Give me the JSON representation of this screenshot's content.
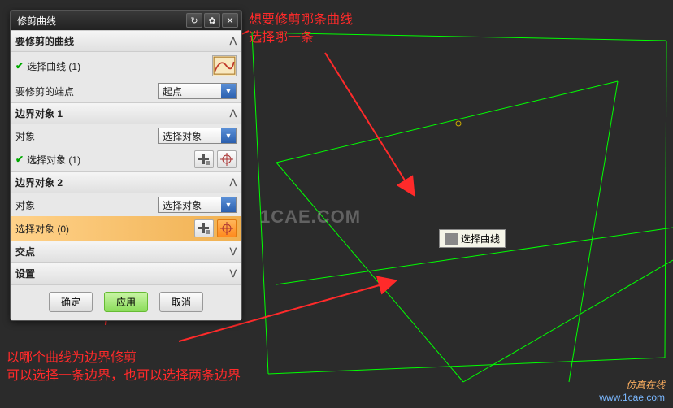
{
  "dialog": {
    "title": "修剪曲线",
    "sections": {
      "s1": {
        "header": "要修剪的曲线"
      },
      "s2": {
        "header": "边界对象 1"
      },
      "s3": {
        "header": "边界对象 2"
      },
      "s4": {
        "header": "交点"
      },
      "s5": {
        "header": "设置"
      }
    },
    "rows": {
      "selectCurve": {
        "label": "选择曲线 (1)"
      },
      "trimEnd": {
        "label": "要修剪的端点",
        "value": "起点"
      },
      "obj1": {
        "label": "对象",
        "value": "选择对象"
      },
      "selObj1": {
        "label": "选择对象 (1)"
      },
      "obj2": {
        "label": "对象",
        "value": "选择对象"
      },
      "selObj2": {
        "label": "选择对象 (0)"
      }
    },
    "buttons": {
      "ok": "确定",
      "apply": "应用",
      "cancel": "取消"
    }
  },
  "annotations": {
    "a1": "想要修剪哪条曲线\n选择哪一条",
    "a2": "以哪个曲线为边界修剪\n可以选择一条边界，也可以选择两条边界"
  },
  "tooltip": {
    "text": "选择曲线"
  },
  "watermark": "1CAE.COM",
  "site": {
    "line1": "仿真在线",
    "line2": "www.1cae.com"
  }
}
